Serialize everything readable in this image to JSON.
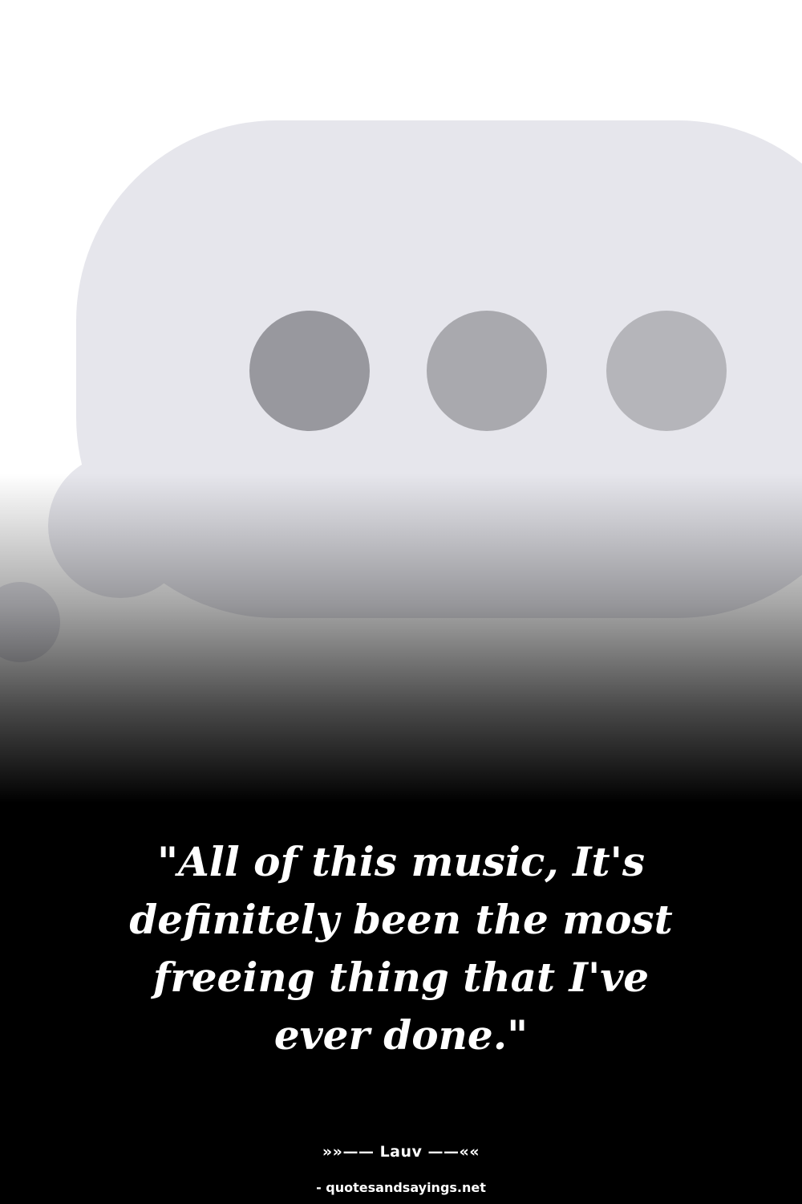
{
  "quote": {
    "text": "\"All of this music, It's definitely been the most freeing thing that I've ever done.\""
  },
  "attribution": {
    "author": "»»—— Lauv ——««"
  },
  "source": {
    "site": "- quotesandsayings.net"
  },
  "illustration": {
    "icon": "thought-bubble-typing-icon",
    "colors": {
      "bubble": "#e6e6ec",
      "dot_dark": "#98989e",
      "dot_mid": "#a9a9ae",
      "dot_light": "#b5b5ba"
    }
  }
}
